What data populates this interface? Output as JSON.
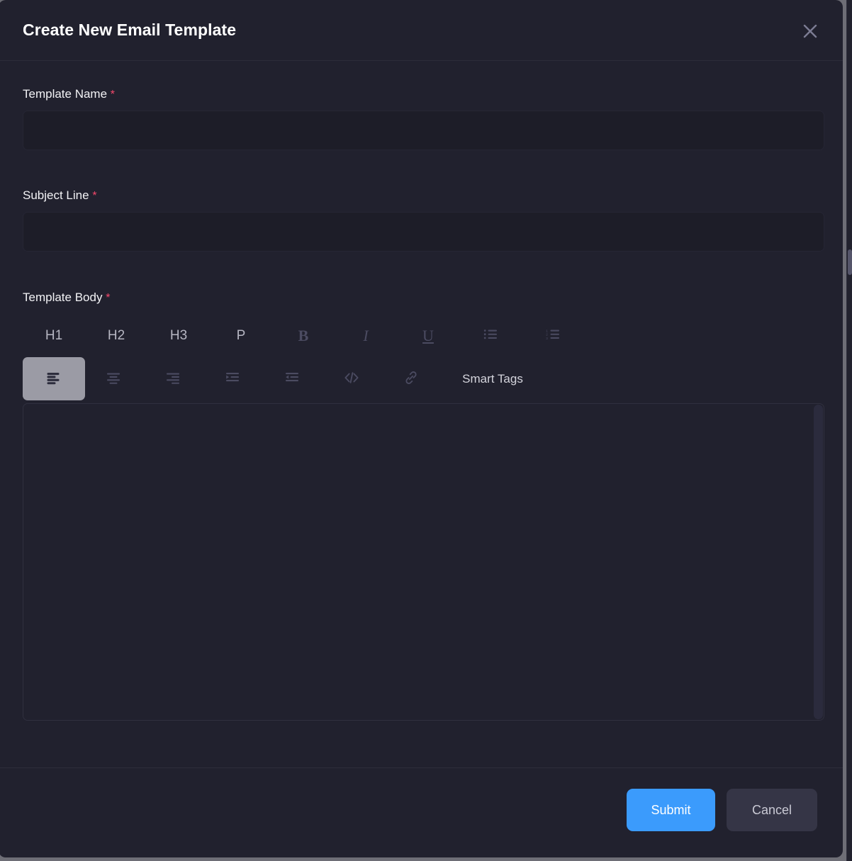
{
  "modal": {
    "title": "Create New Email Template",
    "close_icon": "close-icon"
  },
  "form": {
    "template_name": {
      "label": "Template Name",
      "required_marker": "*",
      "value": "",
      "placeholder": ""
    },
    "subject_line": {
      "label": "Subject Line",
      "required_marker": "*",
      "value": "",
      "placeholder": ""
    },
    "template_body": {
      "label": "Template Body",
      "required_marker": "*",
      "value": "",
      "placeholder": ""
    }
  },
  "toolbar": {
    "row1": [
      {
        "label": "H1",
        "name": "heading-1-button",
        "style": "text",
        "active": false
      },
      {
        "label": "H2",
        "name": "heading-2-button",
        "style": "text",
        "active": false
      },
      {
        "label": "H3",
        "name": "heading-3-button",
        "style": "text",
        "active": false
      },
      {
        "label": "P",
        "name": "paragraph-button",
        "style": "text",
        "active": false
      },
      {
        "label": "B",
        "name": "bold-button",
        "style": "serif-bold",
        "active": false
      },
      {
        "label": "I",
        "name": "italic-button",
        "style": "serif-italic",
        "active": false
      },
      {
        "label": "U",
        "name": "underline-button",
        "style": "serif-underline",
        "active": false
      },
      {
        "label": "",
        "name": "bullet-list-icon",
        "style": "icon",
        "icon": "bullet-list",
        "active": false
      },
      {
        "label": "",
        "name": "numbered-list-icon",
        "style": "icon",
        "icon": "numbered-list",
        "active": false
      }
    ],
    "row2": [
      {
        "label": "",
        "name": "align-left-button",
        "style": "icon",
        "icon": "align-left",
        "active": true
      },
      {
        "label": "",
        "name": "align-center-button",
        "style": "icon",
        "icon": "align-center",
        "active": false
      },
      {
        "label": "",
        "name": "align-right-button",
        "style": "icon",
        "icon": "align-right",
        "active": false
      },
      {
        "label": "",
        "name": "indent-increase-button",
        "style": "icon",
        "icon": "indent-right",
        "active": false
      },
      {
        "label": "",
        "name": "indent-decrease-button",
        "style": "icon",
        "icon": "indent-left",
        "active": false
      },
      {
        "label": "",
        "name": "code-block-button",
        "style": "icon",
        "icon": "code",
        "active": false
      },
      {
        "label": "",
        "name": "insert-link-button",
        "style": "icon",
        "icon": "link",
        "active": false
      },
      {
        "label": "Smart Tags",
        "name": "smart-tags-button",
        "style": "text-wide",
        "active": false
      }
    ]
  },
  "footer": {
    "submit_label": "Submit",
    "cancel_label": "Cancel"
  },
  "colors": {
    "modal_background": "#21212e",
    "input_background": "#1d1d28",
    "accent_blue": "#3b9bfc",
    "required_red": "#f4486b",
    "active_toolbar": "#9b9ba5",
    "cancel_button": "#353546"
  }
}
